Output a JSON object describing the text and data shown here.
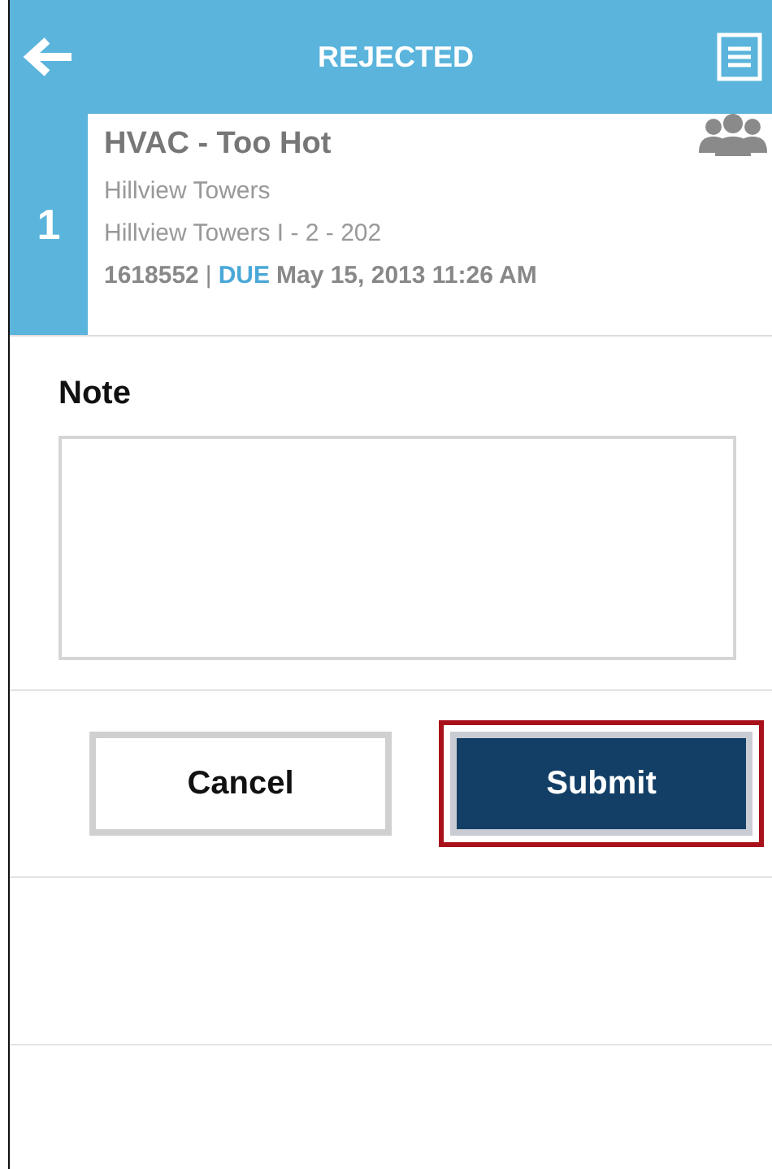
{
  "header": {
    "title": "REJECTED"
  },
  "work_order": {
    "index": "1",
    "title": "HVAC - Too Hot",
    "property": "Hillview Towers",
    "unit": "Hillview Towers I - 2 - 202",
    "number": "1618552",
    "separator": "|",
    "due_label": "DUE",
    "due_date": "May 15, 2013 11:26 AM"
  },
  "note": {
    "label": "Note"
  },
  "buttons": [
    {
      "label": "Cancel",
      "kind": "secondary",
      "highlighted": false
    },
    {
      "label": "Submit",
      "kind": "primary",
      "highlighted": true
    }
  ]
}
